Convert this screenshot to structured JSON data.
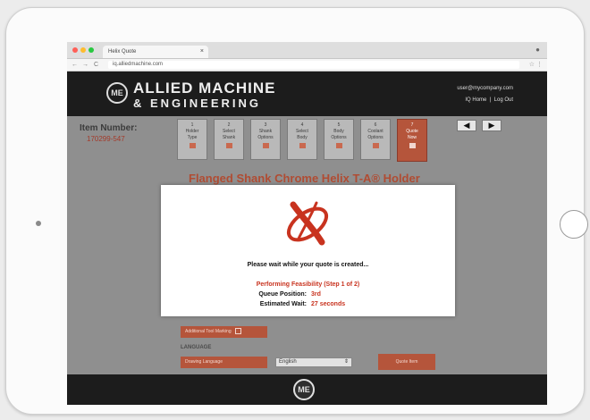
{
  "browser": {
    "tab_title": "Helix Quote",
    "url": "iq.alliedmachine.com",
    "controls": [
      "←",
      "→",
      "C"
    ]
  },
  "header": {
    "brand_line1": "ALLIED MACHINE",
    "brand_line2": "& ENGINEERING",
    "logo_mark": "ME",
    "user_email": "user@mycompany.com",
    "home_link": "IQ Home",
    "separator": "|",
    "logout_link": "Log Out"
  },
  "item": {
    "label": "Item Number:",
    "value": "170299-547"
  },
  "steps": [
    {
      "num": "1",
      "line1": "Holder",
      "line2": "Type"
    },
    {
      "num": "2",
      "line1": "Select",
      "line2": "Shank"
    },
    {
      "num": "3",
      "line1": "Shank",
      "line2": "Options"
    },
    {
      "num": "4",
      "line1": "Select",
      "line2": "Body"
    },
    {
      "num": "5",
      "line1": "Body",
      "line2": "Options"
    },
    {
      "num": "6",
      "line1": "Coolant",
      "line2": "Options"
    },
    {
      "num": "7",
      "line1": "Quote",
      "line2": "Now"
    }
  ],
  "nav_arrows": {
    "prev": "◀",
    "next": "▶"
  },
  "product": {
    "title": "Flanged Shank Chrome Helix T-A® Holder"
  },
  "form": {
    "additional_marking": "Additional Tool Marking",
    "language_heading": "LANGUAGE",
    "drawing_language_label": "Drawing Language",
    "language_value": "English",
    "quote_button": "Quote Item"
  },
  "modal": {
    "message": "Please wait while your quote is created...",
    "feasibility": "Performing Feasibility (Step 1 of 2)",
    "queue_label": "Queue Position:",
    "queue_value": "3rd",
    "wait_label": "Estimated Wait:",
    "wait_value": "27 seconds"
  },
  "colors": {
    "accent": "#b5553b",
    "modal_red": "#c8331f",
    "header_bg": "#1c1c1c"
  }
}
